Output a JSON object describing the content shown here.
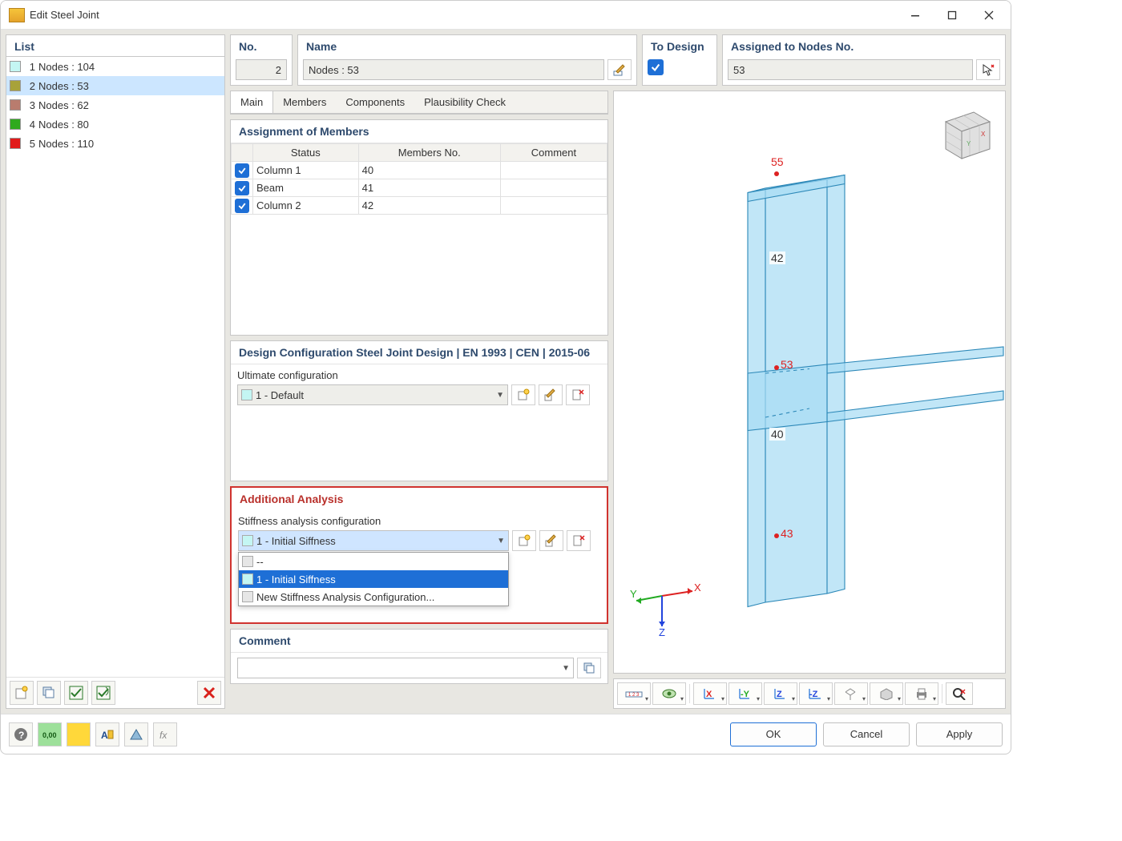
{
  "window": {
    "title": "Edit Steel Joint"
  },
  "list": {
    "header": "List",
    "items": [
      {
        "ix": "1",
        "label": "Nodes : 104",
        "color": "#c4f6f3"
      },
      {
        "ix": "2",
        "label": "Nodes : 53",
        "color": "#a8a23a",
        "selected": true
      },
      {
        "ix": "3",
        "label": "Nodes : 62",
        "color": "#b97c6e"
      },
      {
        "ix": "4",
        "label": "Nodes : 80",
        "color": "#2faa1e"
      },
      {
        "ix": "5",
        "label": "Nodes : 110",
        "color": "#e11b1b"
      }
    ]
  },
  "header": {
    "no_label": "No.",
    "no_value": "2",
    "name_label": "Name",
    "name_value": "Nodes : 53",
    "todesign_label": "To Design",
    "todesign_checked": true,
    "nodes_label": "Assigned to Nodes No.",
    "nodes_value": "53"
  },
  "tabs": {
    "items": [
      "Main",
      "Members",
      "Components",
      "Plausibility Check"
    ],
    "active": 0
  },
  "assignment": {
    "title": "Assignment of Members",
    "cols": [
      "Status",
      "Members No.",
      "Comment"
    ],
    "rows": [
      {
        "checked": true,
        "status": "Column 1",
        "members": "40",
        "comment": ""
      },
      {
        "checked": true,
        "status": "Beam",
        "members": "41",
        "comment": ""
      },
      {
        "checked": true,
        "status": "Column 2",
        "members": "42",
        "comment": ""
      }
    ]
  },
  "design_config": {
    "title": "Design Configuration Steel Joint Design | EN 1993 | CEN | 2015-06",
    "subtitle": "Ultimate configuration",
    "value": "1 - Default"
  },
  "addl": {
    "title": "Additional Analysis",
    "subtitle": "Stiffness analysis configuration",
    "value": "1 - Initial Siffness",
    "options": [
      "--",
      "1 - Initial Siffness",
      "New Stiffness Analysis Configuration..."
    ],
    "selected_index": 1
  },
  "comment": {
    "title": "Comment",
    "value": ""
  },
  "viewport": {
    "members": {
      "top": "42",
      "bottom": "40"
    },
    "nodes": {
      "top": "55",
      "mid": "53",
      "bottom": "43"
    },
    "axes": {
      "x": "X",
      "y": "Y",
      "z": "Z"
    }
  },
  "footer": {
    "ok": "OK",
    "cancel": "Cancel",
    "apply": "Apply"
  }
}
